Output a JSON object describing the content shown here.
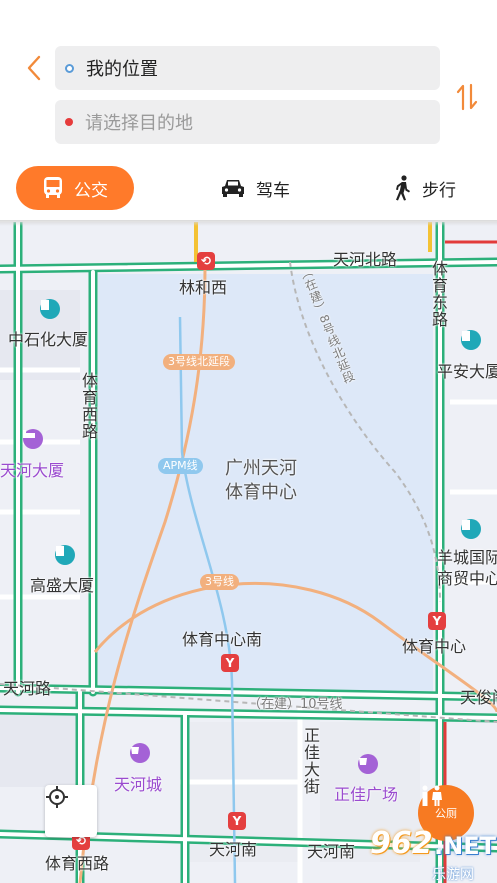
{
  "header": {
    "origin_value": "我的位置",
    "destination_placeholder": "请选择目的地"
  },
  "modes": [
    {
      "label": "公交",
      "active": true
    },
    {
      "label": "驾车",
      "active": false
    },
    {
      "label": "步行",
      "active": false
    }
  ],
  "colors": {
    "accent": "#ff7a2a",
    "road_green": "#2cb07a",
    "line3": "#f2b07e",
    "apm": "#8fc8ee",
    "metro_red": "#e43f3f",
    "venue": "#dde8f8"
  },
  "map": {
    "roads": {
      "tianhe_bei": "天河北路",
      "tiyu_dong": "体育东路",
      "tiyu_xi": "体育西路",
      "tianhe_lu": "天河路",
      "zhengjia_st": "正佳大街",
      "tianhe_nan": "天河南",
      "tiyu_xi_lu_bottom": "体育西路"
    },
    "places": {
      "linhexi": "林和西",
      "sinopec": "中石化大厦",
      "tianhe_building": "天河大厦",
      "gaosheng": "高盛大厦",
      "venue_line1": "广州天河",
      "venue_line2": "体育中心",
      "tiyu_zhongxin_nan": "体育中心南",
      "tianhe_city": "天河城",
      "zhengjia_plaza": "正佳广场",
      "tianhe_nan_station": "天河南",
      "tiyu_zhongxin": "体育中心",
      "pingan": "平安大厦",
      "yangcheng_1": "羊城国际",
      "yangcheng_2": "商贸中心",
      "tianjun": "天俊阁"
    },
    "line_labels": {
      "line3_north": "3号线北延段",
      "apm": "APM线",
      "line3": "3号线",
      "line10": "（在建）10号线",
      "line8_north": "（在建）8号线北延段"
    },
    "toilet_label": "公厕"
  },
  "watermark": {
    "number": "962",
    "suffix": ".NET",
    "subtitle": "乐游网"
  }
}
